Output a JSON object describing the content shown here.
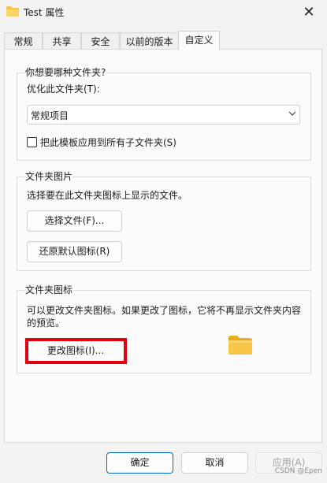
{
  "window": {
    "title": "Test 属性",
    "close_glyph": "✕"
  },
  "tabs": [
    {
      "label": "常规"
    },
    {
      "label": "共享"
    },
    {
      "label": "安全"
    },
    {
      "label": "以前的版本"
    },
    {
      "label": "自定义",
      "active": true
    }
  ],
  "optimize": {
    "group_title": "你想要哪种文件夹?",
    "field_label": "优化此文件夹(T):",
    "combo_value": "常规项目",
    "checkbox_label": "把此模板应用到所有子文件夹(S)",
    "checkbox_checked": false
  },
  "folder_picture": {
    "group_title": "文件夹图片",
    "description": "选择要在此文件夹图标上显示的文件。",
    "choose_file_button": "选择文件(F)...",
    "restore_default_button": "还原默认图标(R)"
  },
  "folder_icon": {
    "group_title": "文件夹图标",
    "description_line1": "可以更改文件夹图标。如果更改了图标，它将不再显示文件夹内容",
    "description_line2": "的预览。",
    "change_icon_button": "更改图标(I)...",
    "highlight_color": "#e4000f"
  },
  "footer": {
    "ok_button": "确定",
    "cancel_button": "取消",
    "apply_button": "应用(A)"
  },
  "watermark": "CSDN @Epen",
  "colors": {
    "accent": "#0067c0",
    "folder": "#f8c74a"
  }
}
